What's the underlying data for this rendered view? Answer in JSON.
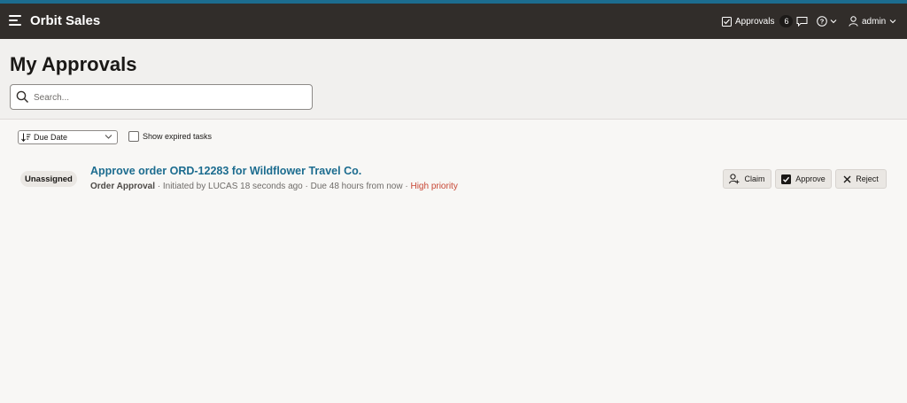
{
  "header": {
    "app_title": "Orbit Sales",
    "approvals_label": "Approvals",
    "approvals_count": "6",
    "user_label": "admin",
    "accent": "#1c6c8f",
    "bar_color": "#312d2a"
  },
  "page": {
    "title": "My Approvals"
  },
  "search": {
    "placeholder": "Search...",
    "value": ""
  },
  "toolbar": {
    "sort_label": "Due Date",
    "expired_label": "Show expired tasks",
    "expired_checked": false
  },
  "tasks": [
    {
      "status": "Unassigned",
      "title": "Approve order ORD-12283 for Wildflower Travel Co.",
      "type": "Order Approval",
      "initiated": " · Initiated by LUCAS 18 seconds ago · Due 48 hours from now · ",
      "priority": "High priority",
      "priority_color": "#c74634",
      "actions": {
        "claim": "Claim",
        "approve": "Approve",
        "reject": "Reject"
      }
    }
  ],
  "icons": [
    "hamburger-icon",
    "checkbox-icon",
    "chat-icon",
    "help-icon",
    "chevron-down-icon",
    "user-icon",
    "search-icon",
    "sort-icon",
    "claim-user-icon",
    "check-icon",
    "close-icon"
  ]
}
